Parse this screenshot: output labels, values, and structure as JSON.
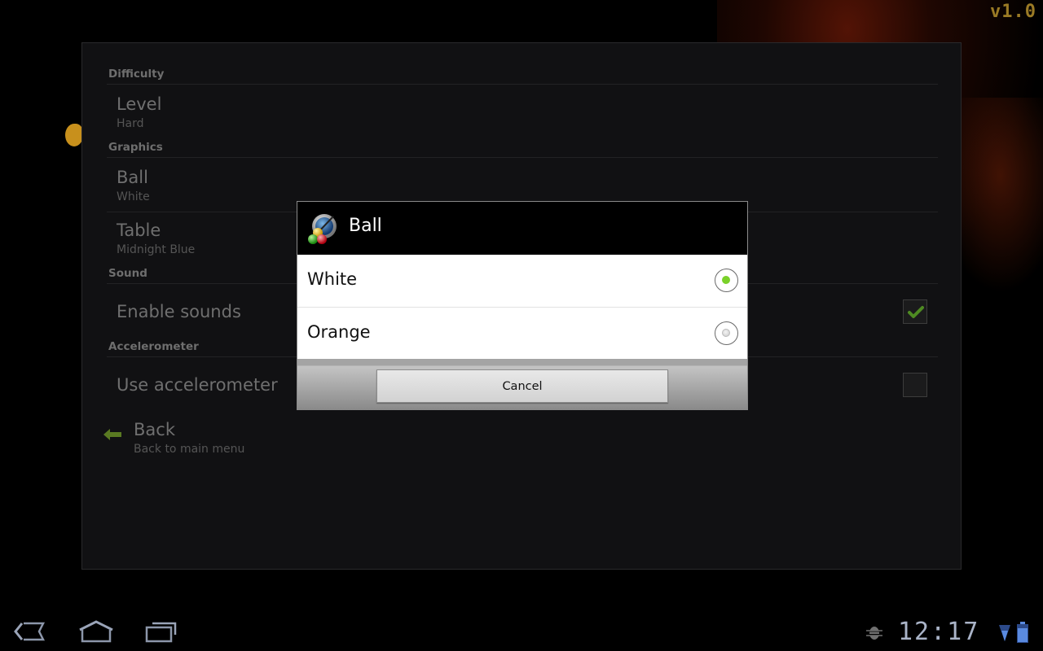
{
  "background": {
    "version_label": "v1.0"
  },
  "preferences": {
    "categories": [
      {
        "label": "Difficulty"
      },
      {
        "label": "Graphics"
      },
      {
        "label": "Sound"
      },
      {
        "label": "Accelerometer"
      }
    ],
    "items": [
      {
        "title": "Level",
        "summary": "Hard"
      },
      {
        "title": "Ball",
        "summary": "White"
      },
      {
        "title": "Table",
        "summary": "Midnight Blue"
      },
      {
        "title": "Enable sounds",
        "checked": true
      },
      {
        "title": "Use accelerometer",
        "checked": false
      },
      {
        "title": "Back",
        "summary": "Back to main menu",
        "icon": "back-arrow-icon"
      }
    ]
  },
  "dialog": {
    "title": "Ball",
    "icon": "pool-balls-app-icon",
    "options": [
      {
        "label": "White",
        "selected": true
      },
      {
        "label": "Orange",
        "selected": false
      }
    ],
    "cancel_label": "Cancel",
    "accent_color": "#7ad12a"
  },
  "system_bar": {
    "nav": [
      "back-icon",
      "home-icon",
      "recent-apps-icon"
    ],
    "status_icons": [
      "debug-bug-icon",
      "wifi-signal-icon",
      "battery-icon"
    ],
    "clock": "12:17"
  }
}
